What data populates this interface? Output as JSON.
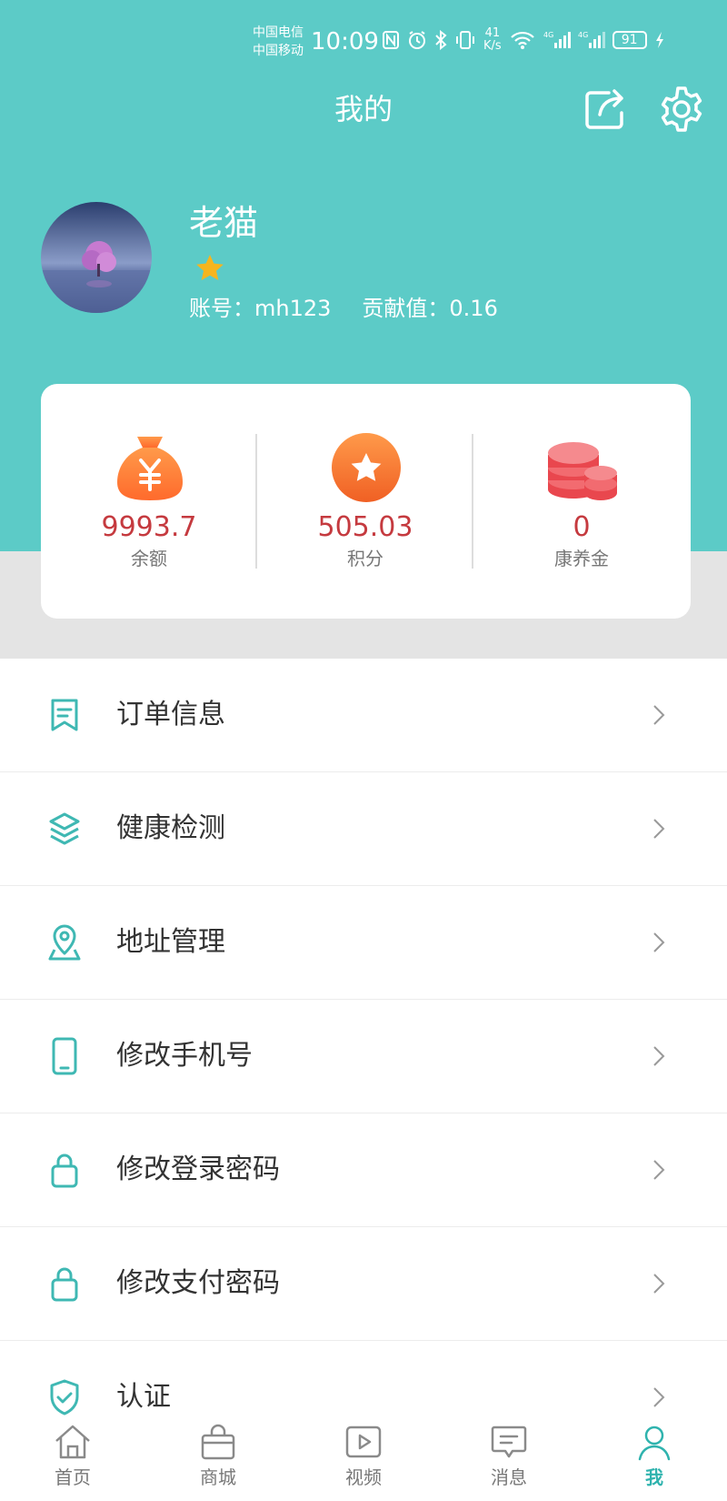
{
  "status_bar": {
    "carrier1": "中国电信",
    "carrier2": "中国移动",
    "time": "10:09",
    "net_speed_value": "41",
    "net_speed_unit": "K/s",
    "battery": "91"
  },
  "header": {
    "title": "我的"
  },
  "profile": {
    "name": "老猫",
    "account_label": "账号：",
    "account_value": "mh123",
    "contribution_label": "贡献值：",
    "contribution_value": "0.16"
  },
  "assets": [
    {
      "value": "9993.7",
      "label": "余额",
      "icon": "money-bag-icon"
    },
    {
      "value": "505.03",
      "label": "积分",
      "icon": "points-star-icon"
    },
    {
      "value": "0",
      "label": "康养金",
      "icon": "coins-stack-icon"
    }
  ],
  "menu": [
    {
      "label": "订单信息",
      "icon": "order-bookmark-icon"
    },
    {
      "label": "健康检测",
      "icon": "layers-icon"
    },
    {
      "label": "地址管理",
      "icon": "location-pin-icon"
    },
    {
      "label": "修改手机号",
      "icon": "phone-icon"
    },
    {
      "label": "修改登录密码",
      "icon": "lock-icon"
    },
    {
      "label": "修改支付密码",
      "icon": "lock-icon"
    },
    {
      "label": "认证",
      "icon": "shield-check-icon"
    }
  ],
  "bottom_nav": [
    {
      "label": "首页",
      "icon": "home-icon",
      "active": false
    },
    {
      "label": "商城",
      "icon": "shopping-bag-icon",
      "active": false
    },
    {
      "label": "视频",
      "icon": "video-play-icon",
      "active": false
    },
    {
      "label": "消息",
      "icon": "message-icon",
      "active": false
    },
    {
      "label": "我",
      "icon": "user-icon",
      "active": true
    }
  ],
  "colors": {
    "header_bg": "#5ccbc7",
    "accent": "#2fb3ae",
    "value_red": "#c53a3f"
  }
}
